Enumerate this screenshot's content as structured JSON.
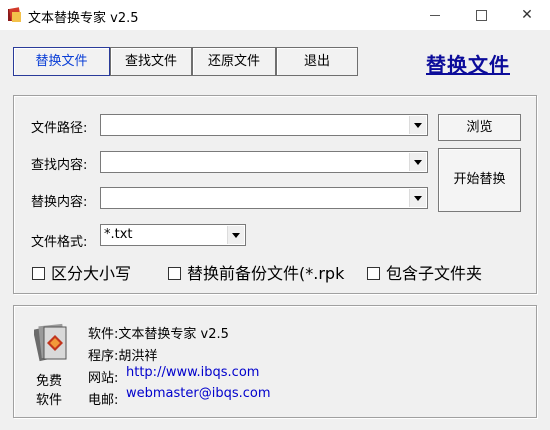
{
  "window": {
    "title": "文本替换专家 v2.5",
    "min_glyph": "",
    "max_glyph": "",
    "close_glyph": "✕"
  },
  "toolbar": {
    "items": [
      {
        "label": "替换文件",
        "active": true
      },
      {
        "label": "查找文件"
      },
      {
        "label": "还原文件"
      },
      {
        "label": "退出"
      }
    ]
  },
  "brand_title": "替换文件",
  "form": {
    "path_label": "文件路径:",
    "path_value": "",
    "browse_label": "浏览",
    "find_label": "查找内容:",
    "find_value": "",
    "replace_label": "替换内容:",
    "replace_value": "",
    "start_label": "开始替换",
    "format_label": "文件格式:",
    "format_value": "*.txt",
    "checkboxes": [
      {
        "label": "区分大小写",
        "checked": false
      },
      {
        "label": "替换前备份文件(*.rpk",
        "checked": false
      },
      {
        "label": "包含子文件夹",
        "checked": false
      }
    ]
  },
  "about": {
    "icon_caption_1": "免费",
    "icon_caption_2": "软件",
    "software": "软件:文本替换专家 v2.5",
    "author": "程序:胡洪祥",
    "site_label": "网站:",
    "site_url": "http://www.ibqs.com",
    "mail_label": "电邮:",
    "mail": "webmaster@ibqs.com"
  }
}
